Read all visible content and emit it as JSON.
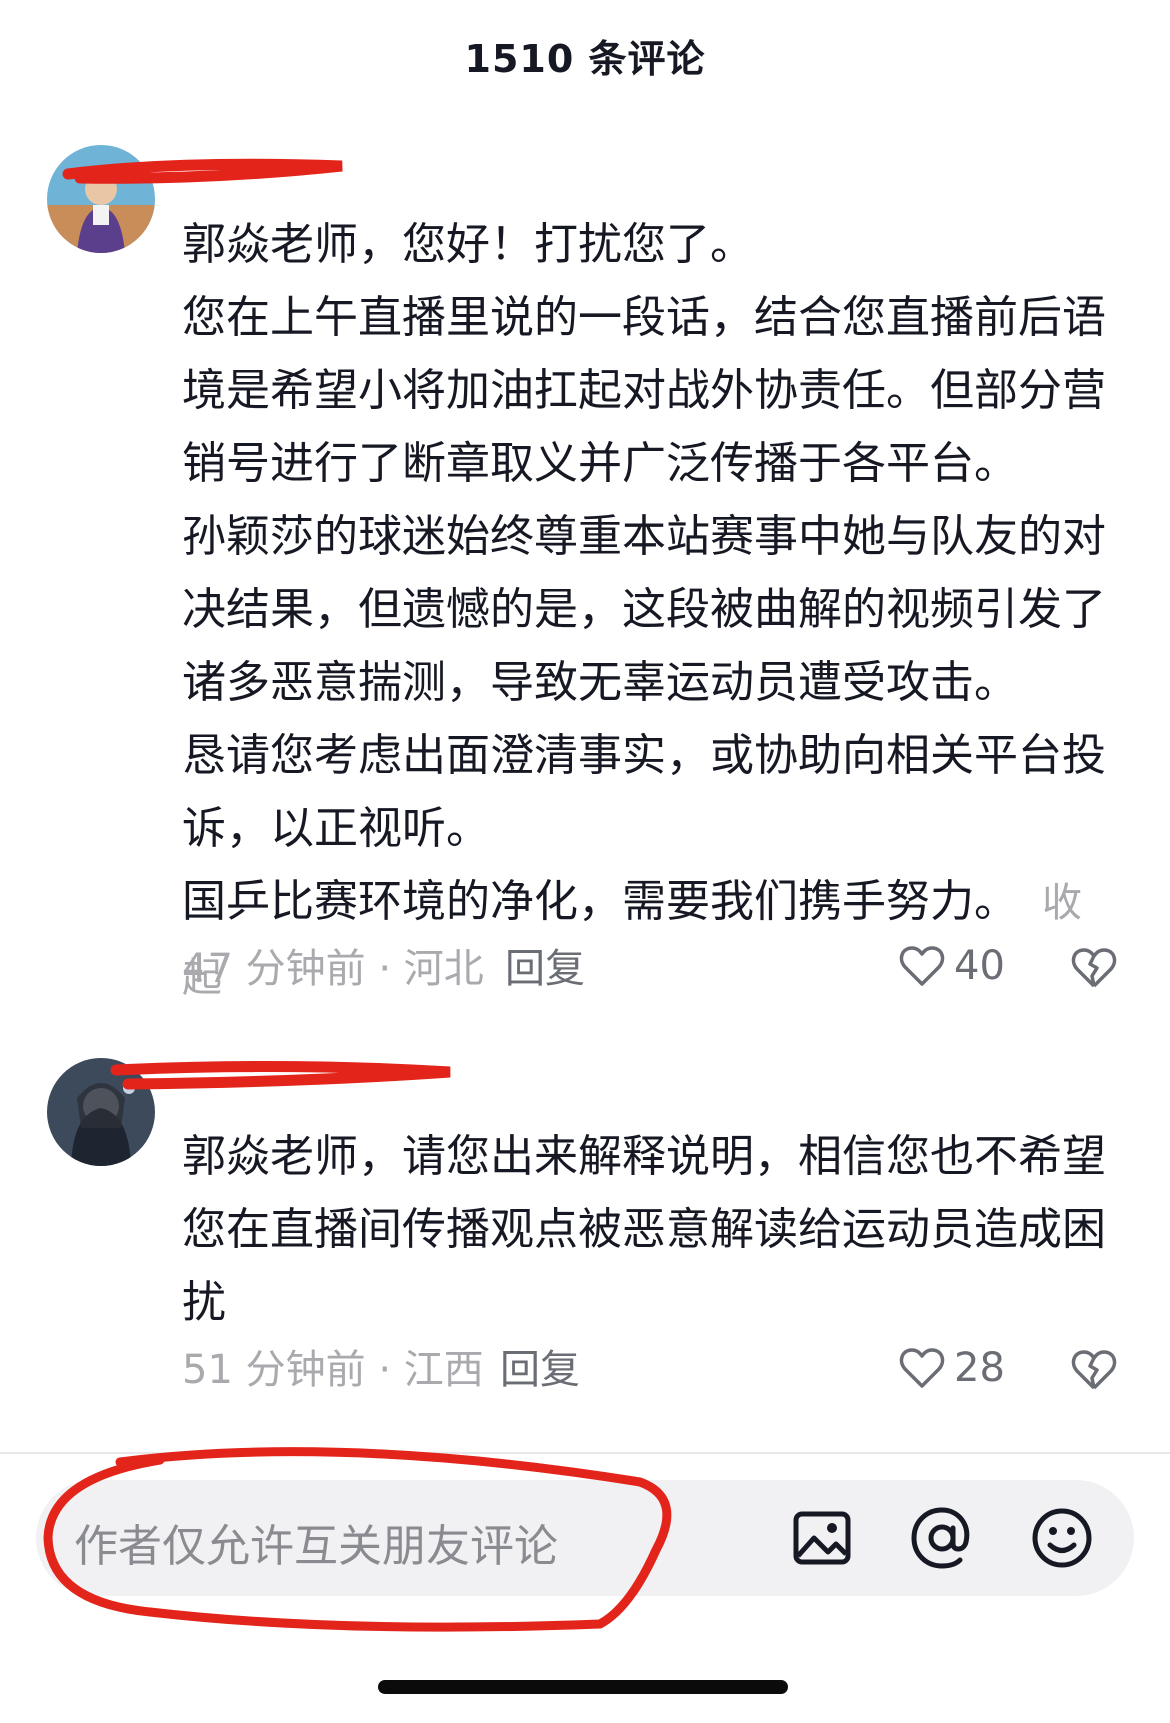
{
  "header": {
    "title": "1510 条评论"
  },
  "comments": [
    {
      "paragraphs": [
        "郭焱老师，您好！打扰您了。",
        "您在上午直播里说的一段话，结合您直播前后语境是希望小将加油扛起对战外协责任。但部分营销号进行了断章取义并广泛传播于各平台。",
        "孙颖莎的球迷始终尊重本站赛事中她与队友的对决结果，但遗憾的是，这段被曲解的视频引发了诸多恶意揣测，导致无辜运动员遭受攻击。",
        "恳请您考虑出面澄清事实，或协助向相关平台投诉，以正视听。",
        "国乒比赛环境的净化，需要我们携手努力。"
      ],
      "collapse_label": "收起",
      "time": "47 分钟前 · 河北",
      "reply_label": "回复",
      "likes": "40"
    },
    {
      "paragraphs": [
        "郭焱老师，请您出来解释说明，相信您也不希望您在直播间传播观点被恶意解读给运动员造成困扰"
      ],
      "time": "51 分钟前 · 江西",
      "reply_label": "回复",
      "likes": "28"
    }
  ],
  "input_bar": {
    "placeholder": "作者仅允许互关朋友评论",
    "icons": [
      "image-icon",
      "at-icon",
      "emoji-icon"
    ]
  },
  "colors": {
    "primary_text": "#161823",
    "secondary_text": "#a9a9ae",
    "annotation_red": "#e3241b",
    "input_bg": "#f1f1f3"
  }
}
